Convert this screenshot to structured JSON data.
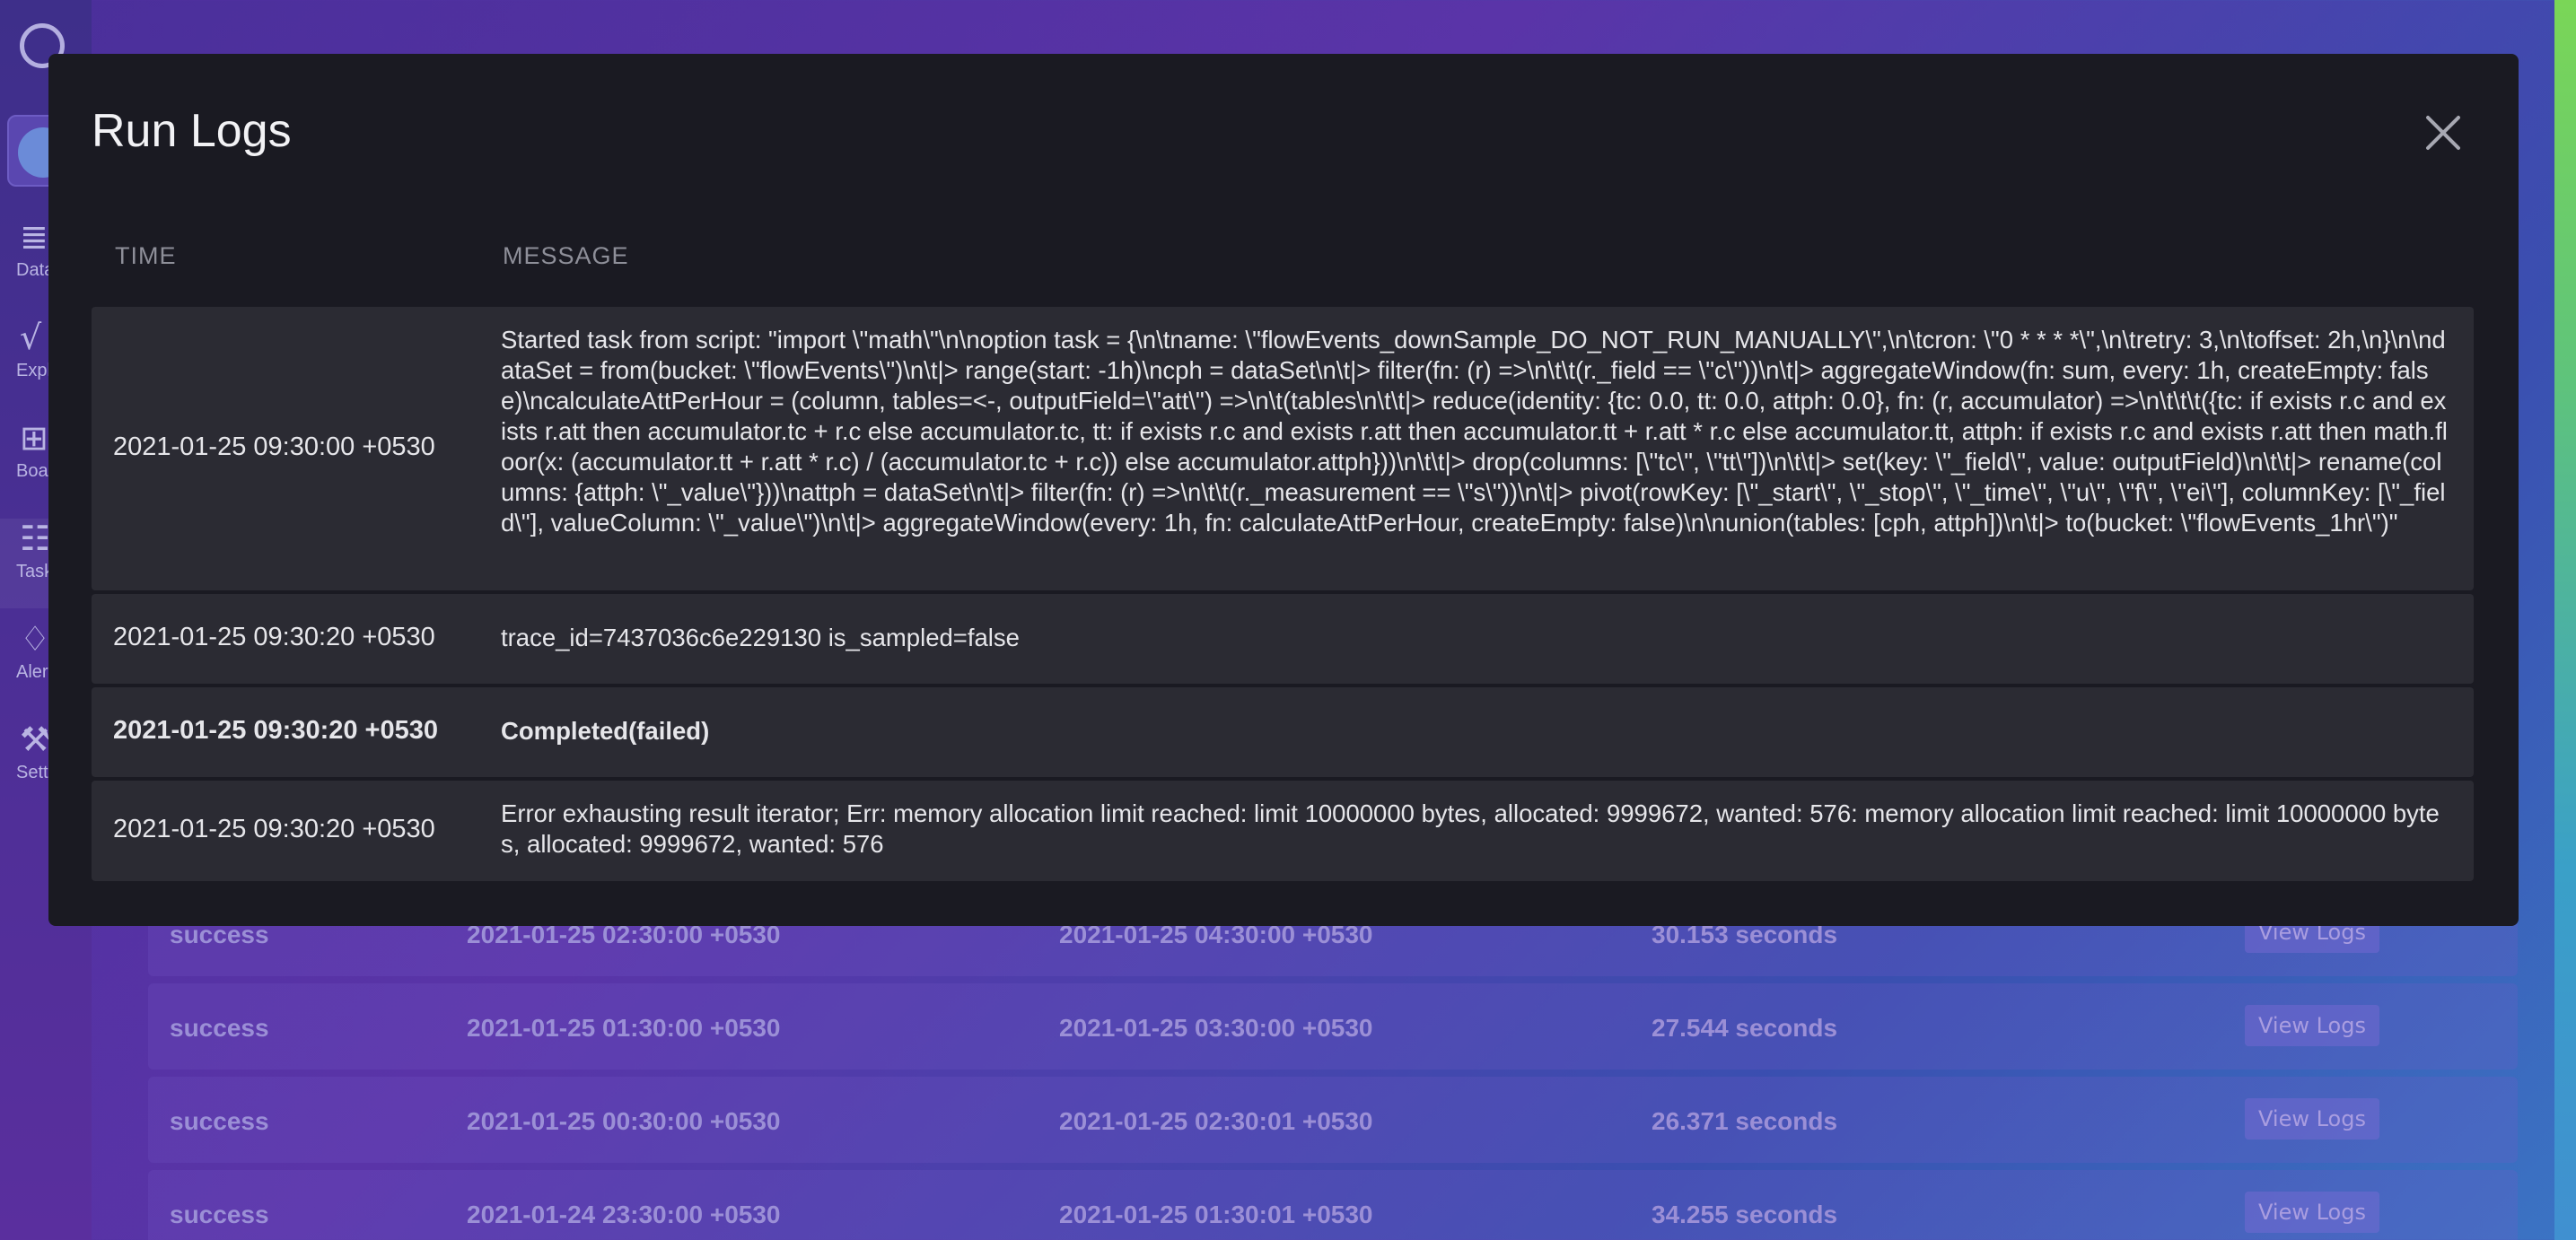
{
  "sidebar": {
    "items": [
      {
        "icon": "database-icon",
        "glyph": "≣",
        "label": "Data"
      },
      {
        "icon": "explore-icon",
        "glyph": "√",
        "label": "Explore"
      },
      {
        "icon": "boards-icon",
        "glyph": "⊞",
        "label": "Boards"
      },
      {
        "icon": "tasks-icon",
        "glyph": "☷",
        "label": "Tasks"
      },
      {
        "icon": "alerts-icon",
        "glyph": "♢",
        "label": "Alerts"
      },
      {
        "icon": "settings-icon",
        "glyph": "⚒",
        "label": "Settings"
      }
    ]
  },
  "background_runs": [
    {
      "status": "success",
      "scheduled": "2021-01-25 02:30:00 +0530",
      "finished": "2021-01-25 04:30:00 +0530",
      "duration": "30.153 seconds",
      "action": "View Logs"
    },
    {
      "status": "success",
      "scheduled": "2021-01-25 01:30:00 +0530",
      "finished": "2021-01-25 03:30:00 +0530",
      "duration": "27.544 seconds",
      "action": "View Logs"
    },
    {
      "status": "success",
      "scheduled": "2021-01-25 00:30:00 +0530",
      "finished": "2021-01-25 02:30:01 +0530",
      "duration": "26.371 seconds",
      "action": "View Logs"
    },
    {
      "status": "success",
      "scheduled": "2021-01-24 23:30:00 +0530",
      "finished": "2021-01-25 01:30:01 +0530",
      "duration": "34.255 seconds",
      "action": "View Logs"
    }
  ],
  "modal": {
    "title": "Run Logs",
    "columns": {
      "time": "TIME",
      "message": "MESSAGE"
    },
    "rows": [
      {
        "time": "2021-01-25 09:30:00 +0530",
        "message": "Started task from script: \"import \\\"math\\\"\\n\\noption task = {\\n\\tname: \\\"flowEvents_downSample_DO_NOT_RUN_MANUALLY\\\",\\n\\tcron: \\\"0 * * * *\\\",\\n\\tretry: 3,\\n\\toffset: 2h,\\n}\\n\\ndataSet = from(bucket: \\\"flowEvents\\\")\\n\\t|> range(start: -1h)\\ncph = dataSet\\n\\t|> filter(fn: (r) =>\\n\\t\\t(r._field == \\\"c\\\"))\\n\\t|> aggregateWindow(fn: sum, every: 1h, createEmpty: false)\\ncalculateAttPerHour = (column, tables=<-, outputField=\\\"att\\\") =>\\n\\t(tables\\n\\t\\t|> reduce(identity: {tc: 0.0, tt: 0.0, attph: 0.0}, fn: (r, accumulator) =>\\n\\t\\t\\t({tc: if exists r.c and exists r.att then accumulator.tc + r.c else accumulator.tc, tt: if exists r.c and exists r.att then accumulator.tt + r.att * r.c else accumulator.tt, attph: if exists r.c and exists r.att then math.floor(x: (accumulator.tt + r.att * r.c) / (accumulator.tc + r.c)) else accumulator.attph}))\\n\\t\\t|> drop(columns: [\\\"tc\\\", \\\"tt\\\"])\\n\\t\\t|> set(key: \\\"_field\\\", value: outputField)\\n\\t\\t|> rename(columns: {attph: \\\"_value\\\"}))\\nattph = dataSet\\n\\t|> filter(fn: (r) =>\\n\\t\\t(r._measurement == \\\"s\\\"))\\n\\t|> pivot(rowKey: [\\\"_start\\\", \\\"_stop\\\", \\\"_time\\\", \\\"u\\\", \\\"f\\\", \\\"ei\\\"], columnKey: [\\\"_field\\\"], valueColumn: \\\"_value\\\")\\n\\t|> aggregateWindow(every: 1h, fn: calculateAttPerHour, createEmpty: false)\\n\\nunion(tables: [cph, attph])\\n\\t|> to(bucket: \\\"flowEvents_1hr\\\")\""
      },
      {
        "time": "2021-01-25 09:30:20 +0530",
        "message": "trace_id=7437036c6e229130 is_sampled=false"
      },
      {
        "time": "2021-01-25 09:30:20 +0530",
        "message": "Completed(failed)"
      },
      {
        "time": "2021-01-25 09:30:20 +0530",
        "message": "Error exhausting result iterator; Err: memory allocation limit reached: limit 10000000 bytes, allocated: 9999672, wanted: 576: memory allocation limit reached: limit 10000000 bytes, allocated: 9999672, wanted: 576"
      }
    ]
  }
}
